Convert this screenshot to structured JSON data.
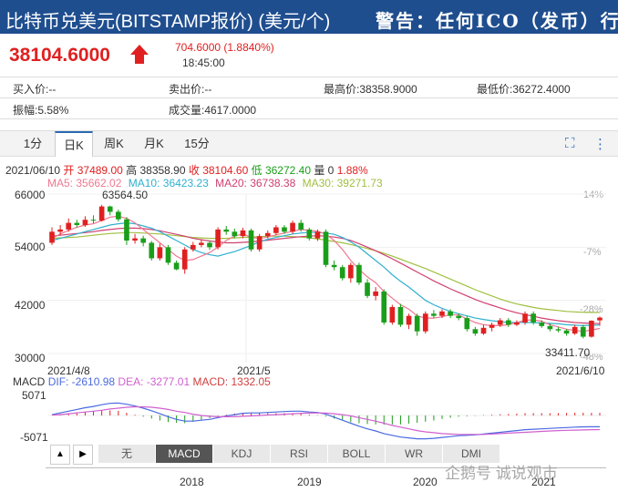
{
  "header": {
    "title": "比特币兑美元(BITSTAMP报价) (美元/个)",
    "warning": "警告：任何ICO（发币）行"
  },
  "quote": {
    "price": "38104.6000",
    "change": "704.6000 (1.8840%)",
    "time": "18:45:00"
  },
  "stats": {
    "bid": "买入价:--",
    "ask": "卖出价:--",
    "high": "最高价:38358.9000",
    "low": "最低价:36272.4000",
    "amplitude": "振幅:5.58%",
    "volume": "成交量:4617.0000"
  },
  "tabs": [
    "1分",
    "日K",
    "周K",
    "月K",
    "15分"
  ],
  "active_tab": "日K",
  "icons": {
    "fullscreen": "fullscreen-icon",
    "more": "more-vertical-icon"
  },
  "ohlc_line": {
    "date": "2021/06/10",
    "open": "开 37489.00",
    "high": "高 38358.90",
    "close": "收 38104.60",
    "low": "低 36272.40",
    "vol": "量 0",
    "pct": "1.88%"
  },
  "ma_line": {
    "ma5": "MA5: 35662.02",
    "ma10": "MA10: 36423.23",
    "ma20": "MA20: 36738.38",
    "ma30": "MA30: 39271.73"
  },
  "colors": {
    "up": "#e02020",
    "down": "#1a9e1a",
    "ma5": "#f07890",
    "ma10": "#30b0d0",
    "ma20": "#d04070",
    "ma30": "#a0c040",
    "header_bg": "#1f4e8f"
  },
  "price_axis": [
    "66000",
    "54000",
    "42000",
    "30000"
  ],
  "pct_axis": [
    "14%",
    "-7%",
    "-28%",
    "-48%"
  ],
  "annotations": {
    "peak": "63564.50",
    "trough": "33411.70"
  },
  "date_axis": [
    "2021/4/8",
    "2021/5",
    "2021/6/10"
  ],
  "macd_line": {
    "label": "MACD",
    "dif": "DIF: -2610.98",
    "dea": "DEA: -3277.01",
    "macd": "MACD: 1332.05"
  },
  "macd_axis": [
    "5071",
    "-5071"
  ],
  "indicator_tabs": [
    "无",
    "MACD",
    "KDJ",
    "RSI",
    "BOLL",
    "WR",
    "DMI"
  ],
  "active_indicator": "MACD",
  "nav": {
    "prev": "▲",
    "next": "▶"
  },
  "year_axis": [
    "2018",
    "2019",
    "2020",
    "2021"
  ],
  "watermark": "企鹅号 诚说观市",
  "chart_data": {
    "type": "candlestick",
    "x_range": [
      "2021/4/8",
      "2021/6/10"
    ],
    "ylim": [
      30000,
      66000
    ],
    "candles": [
      {
        "o": 55000,
        "c": 57500,
        "h": 58500,
        "l": 54500
      },
      {
        "o": 57500,
        "c": 58000,
        "h": 59000,
        "l": 56800
      },
      {
        "o": 58000,
        "c": 59500,
        "h": 60500,
        "l": 57500
      },
      {
        "o": 59500,
        "c": 59000,
        "h": 60200,
        "l": 58500
      },
      {
        "o": 59000,
        "c": 60200,
        "h": 61000,
        "l": 58600
      },
      {
        "o": 60200,
        "c": 60000,
        "h": 61200,
        "l": 59400
      },
      {
        "o": 60000,
        "c": 63200,
        "h": 63564.5,
        "l": 59800
      },
      {
        "o": 63200,
        "c": 62000,
        "h": 63400,
        "l": 61200
      },
      {
        "o": 62000,
        "c": 60300,
        "h": 62500,
        "l": 59800
      },
      {
        "o": 60300,
        "c": 55500,
        "h": 60800,
        "l": 54500
      },
      {
        "o": 55500,
        "c": 56000,
        "h": 57000,
        "l": 54800
      },
      {
        "o": 56000,
        "c": 55000,
        "h": 56600,
        "l": 54200
      },
      {
        "o": 55000,
        "c": 51500,
        "h": 55400,
        "l": 51000
      },
      {
        "o": 51500,
        "c": 54000,
        "h": 54800,
        "l": 51000
      },
      {
        "o": 54000,
        "c": 50500,
        "h": 54500,
        "l": 50000
      },
      {
        "o": 50500,
        "c": 49000,
        "h": 51000,
        "l": 48800
      },
      {
        "o": 49000,
        "c": 53500,
        "h": 54000,
        "l": 48000
      },
      {
        "o": 53500,
        "c": 54500,
        "h": 55200,
        "l": 53000
      },
      {
        "o": 54500,
        "c": 55000,
        "h": 55800,
        "l": 54000
      },
      {
        "o": 55000,
        "c": 54000,
        "h": 55500,
        "l": 53400
      },
      {
        "o": 54000,
        "c": 58000,
        "h": 58500,
        "l": 53500
      },
      {
        "o": 58000,
        "c": 57500,
        "h": 58800,
        "l": 56800
      },
      {
        "o": 57500,
        "c": 56500,
        "h": 58200,
        "l": 56000
      },
      {
        "o": 56500,
        "c": 57800,
        "h": 58400,
        "l": 56000
      },
      {
        "o": 57800,
        "c": 53500,
        "h": 58200,
        "l": 53000
      },
      {
        "o": 53500,
        "c": 56500,
        "h": 57000,
        "l": 53000
      },
      {
        "o": 56500,
        "c": 57200,
        "h": 57800,
        "l": 56000
      },
      {
        "o": 57200,
        "c": 58500,
        "h": 59000,
        "l": 56800
      },
      {
        "o": 58500,
        "c": 57500,
        "h": 59000,
        "l": 57000
      },
      {
        "o": 57500,
        "c": 59500,
        "h": 60000,
        "l": 57000
      },
      {
        "o": 59500,
        "c": 58000,
        "h": 60200,
        "l": 57500
      },
      {
        "o": 58000,
        "c": 56000,
        "h": 58400,
        "l": 55500
      },
      {
        "o": 56000,
        "c": 57500,
        "h": 58000,
        "l": 55400
      },
      {
        "o": 57500,
        "c": 50000,
        "h": 58000,
        "l": 49500
      },
      {
        "o": 50000,
        "c": 49500,
        "h": 51000,
        "l": 48800
      },
      {
        "o": 49500,
        "c": 47000,
        "h": 50000,
        "l": 46500
      },
      {
        "o": 47000,
        "c": 50000,
        "h": 50500,
        "l": 46000
      },
      {
        "o": 50000,
        "c": 46000,
        "h": 50500,
        "l": 45500
      },
      {
        "o": 46000,
        "c": 43000,
        "h": 46800,
        "l": 42500
      },
      {
        "o": 43000,
        "c": 44000,
        "h": 45000,
        "l": 42000
      },
      {
        "o": 44000,
        "c": 37000,
        "h": 44500,
        "l": 36500
      },
      {
        "o": 37000,
        "c": 40500,
        "h": 41000,
        "l": 36500
      },
      {
        "o": 40500,
        "c": 36500,
        "h": 41200,
        "l": 36000
      },
      {
        "o": 36500,
        "c": 38500,
        "h": 39000,
        "l": 35500
      },
      {
        "o": 38500,
        "c": 35000,
        "h": 39000,
        "l": 34000
      },
      {
        "o": 35000,
        "c": 39000,
        "h": 39500,
        "l": 34500
      },
      {
        "o": 39000,
        "c": 38500,
        "h": 39800,
        "l": 38000
      },
      {
        "o": 38500,
        "c": 39500,
        "h": 40000,
        "l": 38000
      },
      {
        "o": 39500,
        "c": 38500,
        "h": 40000,
        "l": 38000
      },
      {
        "o": 38500,
        "c": 38000,
        "h": 39000,
        "l": 37500
      },
      {
        "o": 38000,
        "c": 35500,
        "h": 38500,
        "l": 35000
      },
      {
        "o": 35500,
        "c": 34500,
        "h": 36000,
        "l": 34000
      },
      {
        "o": 34500,
        "c": 35800,
        "h": 36500,
        "l": 34200
      },
      {
        "o": 35800,
        "c": 36500,
        "h": 37000,
        "l": 35000
      },
      {
        "o": 36500,
        "c": 37500,
        "h": 38000,
        "l": 36000
      },
      {
        "o": 37500,
        "c": 36500,
        "h": 38000,
        "l": 36000
      },
      {
        "o": 36500,
        "c": 37000,
        "h": 37500,
        "l": 36200
      },
      {
        "o": 37000,
        "c": 39000,
        "h": 39500,
        "l": 36500
      },
      {
        "o": 39000,
        "c": 37000,
        "h": 39500,
        "l": 36500
      },
      {
        "o": 37000,
        "c": 36200,
        "h": 37500,
        "l": 35800
      },
      {
        "o": 36200,
        "c": 35500,
        "h": 36800,
        "l": 35000
      },
      {
        "o": 35500,
        "c": 35200,
        "h": 36000,
        "l": 34800
      },
      {
        "o": 35200,
        "c": 34500,
        "h": 35500,
        "l": 34000
      },
      {
        "o": 34500,
        "c": 36000,
        "h": 36500,
        "l": 34200
      },
      {
        "o": 36000,
        "c": 33800,
        "h": 36500,
        "l": 33411.7
      },
      {
        "o": 33800,
        "c": 37400,
        "h": 37500,
        "l": 33600
      },
      {
        "o": 37489,
        "c": 38104.6,
        "h": 38358.9,
        "l": 36272.4
      }
    ],
    "ma5": [
      56000,
      57000,
      57800,
      58500,
      59000,
      59300,
      60000,
      60800,
      61000,
      60500,
      59500,
      58000,
      56500,
      55000,
      53500,
      52000,
      51000,
      51200,
      52000,
      52800,
      54000,
      55500,
      56500,
      57000,
      56200,
      56000,
      56300,
      56800,
      57200,
      57600,
      58000,
      57800,
      57600,
      57000,
      55500,
      53500,
      51000,
      49000,
      47300,
      46000,
      44000,
      42500,
      41000,
      40000,
      38500,
      38000,
      38000,
      38300,
      38800,
      38700,
      37800,
      37000,
      36500,
      36300,
      36300,
      36500,
      37000,
      37500,
      37600,
      37300,
      36500,
      36000,
      35500,
      35200,
      35000,
      35300,
      35662
    ],
    "ma10": [
      55500,
      56000,
      56500,
      57000,
      57500,
      58000,
      58500,
      59000,
      59300,
      59500,
      59300,
      58800,
      58300,
      57500,
      56500,
      55500,
      54500,
      53500,
      52800,
      52300,
      52000,
      52500,
      53000,
      53700,
      54400,
      55200,
      55800,
      56200,
      56600,
      57000,
      57200,
      57400,
      57300,
      57200,
      56900,
      56200,
      55200,
      54000,
      52500,
      51000,
      49500,
      47800,
      46300,
      45000,
      43500,
      42000,
      41000,
      40200,
      39500,
      39000,
      38500,
      38000,
      37700,
      37400,
      37200,
      37000,
      37000,
      37000,
      37000,
      36900,
      36800,
      36700,
      36500,
      36400,
      36300,
      36400,
      36423
    ],
    "ma20": [
      56500,
      56700,
      56900,
      57100,
      57300,
      57500,
      57800,
      58000,
      58200,
      58300,
      58300,
      58200,
      58000,
      57700,
      57300,
      56900,
      56500,
      56000,
      55700,
      55400,
      55200,
      55000,
      55000,
      55100,
      55200,
      55400,
      55600,
      55800,
      56000,
      56200,
      56400,
      56500,
      56600,
      56500,
      56300,
      56000,
      55500,
      54800,
      54000,
      53200,
      52300,
      51400,
      50400,
      49400,
      48400,
      47400,
      46400,
      45500,
      44600,
      43800,
      43000,
      42200,
      41500,
      40900,
      40300,
      39700,
      39200,
      38800,
      38400,
      38000,
      37700,
      37400,
      37200,
      37000,
      36900,
      36800,
      36738
    ],
    "ma30": [
      56000,
      56100,
      56200,
      56300,
      56500,
      56700,
      56900,
      57100,
      57200,
      57300,
      57300,
      57200,
      57100,
      57000,
      56800,
      56600,
      56400,
      56200,
      56100,
      56000,
      56000,
      56000,
      56100,
      56200,
      56300,
      56400,
      56500,
      56500,
      56500,
      56400,
      56300,
      56100,
      55900,
      55600,
      55300,
      55000,
      54600,
      54200,
      53700,
      53200,
      52600,
      52000,
      51300,
      50600,
      49900,
      49200,
      48400,
      47600,
      46800,
      46000,
      45200,
      44400,
      43700,
      43000,
      42300,
      41700,
      41200,
      40800,
      40400,
      40100,
      39900,
      39700,
      39500,
      39400,
      39300,
      39280,
      39271.73
    ],
    "macd_dif": [
      200,
      600,
      1000,
      1400,
      1800,
      2100,
      2500,
      2800,
      2900,
      2600,
      2200,
      1700,
      1100,
      400,
      -300,
      -900,
      -1300,
      -1300,
      -1100,
      -900,
      -500,
      -100,
      200,
      500,
      600,
      600,
      700,
      800,
      900,
      1000,
      1000,
      800,
      700,
      300,
      -400,
      -1100,
      -1800,
      -2500,
      -3100,
      -3600,
      -4200,
      -4600,
      -5000,
      -5200,
      -5400,
      -5400,
      -5300,
      -5100,
      -4900,
      -4700,
      -4600,
      -4500,
      -4300,
      -4100,
      -3900,
      -3700,
      -3500,
      -3300,
      -3200,
      -3100,
      -3000,
      -2900,
      -2800,
      -2700,
      -2650,
      -2620,
      -2610.98
    ],
    "macd_dea": [
      100,
      200,
      400,
      600,
      800,
      1000,
      1200,
      1500,
      1700,
      1900,
      2000,
      2000,
      1900,
      1700,
      1400,
      1000,
      700,
      300,
      0,
      -200,
      -300,
      -300,
      -300,
      -200,
      -100,
      0,
      100,
      200,
      300,
      400,
      500,
      550,
      600,
      550,
      400,
      200,
      -100,
      -500,
      -900,
      -1300,
      -1800,
      -2300,
      -2700,
      -3100,
      -3500,
      -3800,
      -4000,
      -4200,
      -4300,
      -4400,
      -4400,
      -4400,
      -4400,
      -4300,
      -4200,
      -4100,
      -4000,
      -3900,
      -3800,
      -3700,
      -3600,
      -3500,
      -3450,
      -3400,
      -3350,
      -3300,
      -3277.01
    ],
    "macd_ylim": [
      -5071,
      5071
    ]
  }
}
